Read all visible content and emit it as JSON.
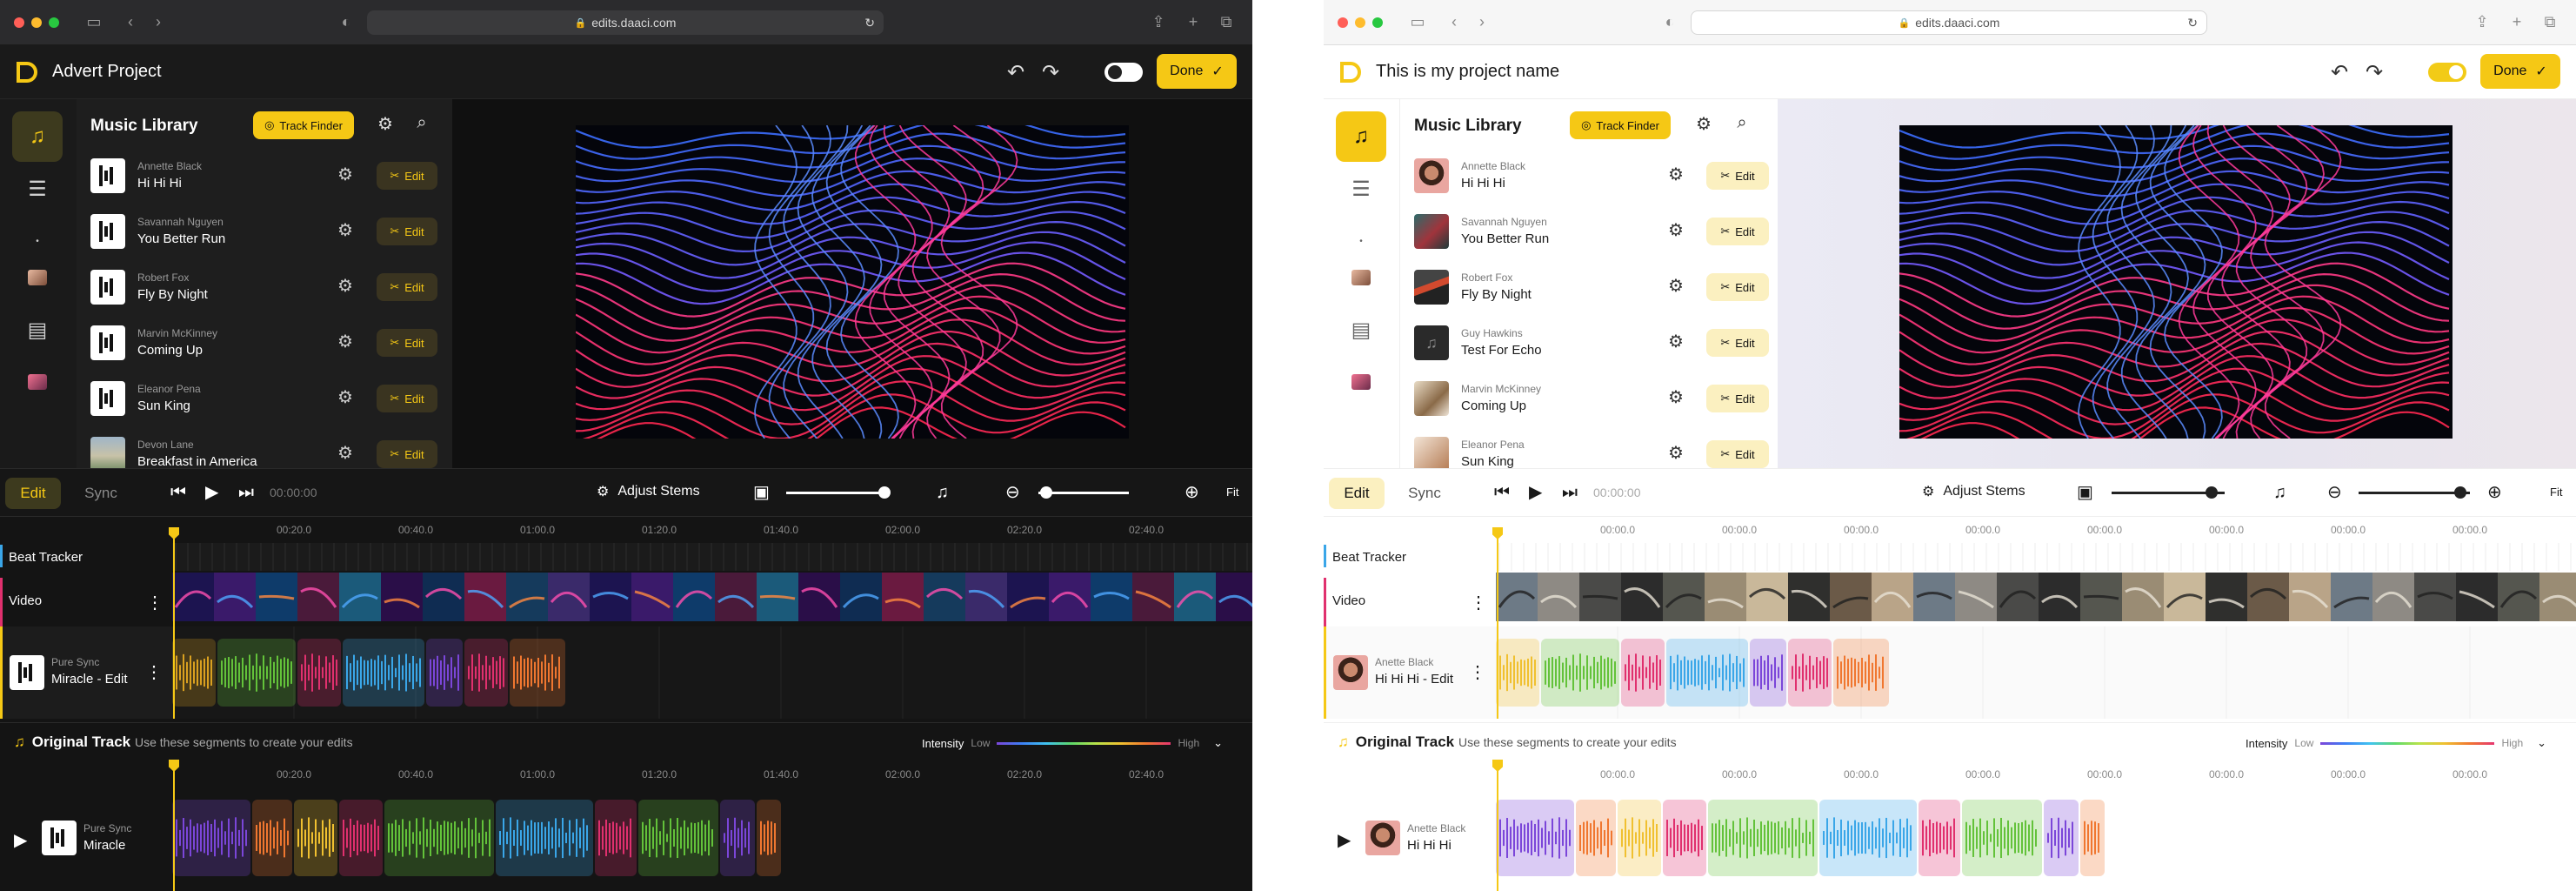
{
  "browser": {
    "url": "edits.daaci.com"
  },
  "dark": {
    "project_name": "Advert Project",
    "done_label": "Done",
    "library_title": "Music Library",
    "track_finder_label": "Track Finder",
    "edit_label": "Edit",
    "tracks": [
      {
        "artist": "Annette Black",
        "title": "Hi Hi Hi"
      },
      {
        "artist": "Savannah Nguyen",
        "title": "You Better Run"
      },
      {
        "artist": "Robert Fox",
        "title": "Fly By Night"
      },
      {
        "artist": "Marvin McKinney",
        "title": "Coming Up"
      },
      {
        "artist": "Eleanor Pena",
        "title": "Sun King"
      },
      {
        "artist": "Devon Lane",
        "title": "Breakfast in America"
      }
    ],
    "timeline": {
      "tab_edit": "Edit",
      "tab_sync": "Sync",
      "timecode": "00:00:00",
      "adjust_stems": "Adjust Stems",
      "fit": "Fit",
      "ruler": [
        "00:20.0",
        "00:40.0",
        "01:00.0",
        "01:20.0",
        "01:40.0",
        "02:00.0",
        "02:20.0",
        "02:40.0"
      ],
      "beat_tracker": "Beat Tracker",
      "video": "Video",
      "music_top": "Pure Sync",
      "music_bottom": "Miracle - Edit"
    },
    "original": {
      "title": "Original Track",
      "subtitle": "Use these segments to create your edits",
      "intensity": "Intensity",
      "low": "Low",
      "high": "High",
      "ruler": [
        "00:20.0",
        "00:40.0",
        "01:00.0",
        "01:20.0",
        "01:40.0",
        "02:00.0",
        "02:20.0",
        "02:40.0"
      ],
      "track_top": "Pure Sync",
      "track_bottom": "Miracle"
    }
  },
  "light": {
    "project_name": "This is my project name",
    "done_label": "Done",
    "library_title": "Music Library",
    "track_finder_label": "Track Finder",
    "edit_label": "Edit",
    "tracks": [
      {
        "artist": "Annette Black",
        "title": "Hi Hi Hi"
      },
      {
        "artist": "Savannah Nguyen",
        "title": "You Better Run"
      },
      {
        "artist": "Robert Fox",
        "title": "Fly By Night"
      },
      {
        "artist": "Guy Hawkins",
        "title": "Test For Echo"
      },
      {
        "artist": "Marvin McKinney",
        "title": "Coming Up"
      },
      {
        "artist": "Eleanor Pena",
        "title": "Sun King"
      }
    ],
    "timeline": {
      "tab_edit": "Edit",
      "tab_sync": "Sync",
      "timecode": "00:00:00",
      "adjust_stems": "Adjust Stems",
      "fit": "Fit",
      "ruler": [
        "00:00.0",
        "00:00.0",
        "00:00.0",
        "00:00.0",
        "00:00.0",
        "00:00.0",
        "00:00.0",
        "00:00.0"
      ],
      "beat_tracker": "Beat Tracker",
      "video": "Video",
      "music_top": "Anette Black",
      "music_bottom": "Hi Hi Hi - Edit"
    },
    "original": {
      "title": "Original Track",
      "subtitle": "Use these segments to create your edits",
      "intensity": "Intensity",
      "low": "Low",
      "high": "High",
      "ruler": [
        "00:00.0",
        "00:00.0",
        "00:00.0",
        "00:00.0",
        "00:00.0",
        "00:00.0",
        "00:00.0",
        "00:00.0"
      ],
      "track_top": "Anette Black",
      "track_bottom": "Hi Hi Hi"
    }
  },
  "colors": {
    "accent": "#f5c815",
    "segments": [
      "#d9a020",
      "#63c23a",
      "#e0306e",
      "#3aa6e8",
      "#7b46d9",
      "#e0306e",
      "#f07730"
    ],
    "orig_segments": [
      "#7b46d9",
      "#f07730",
      "#f0c030",
      "#e0306e",
      "#63c23a",
      "#3aa6e8",
      "#e0306e",
      "#63c23a",
      "#7b46d9",
      "#f07730"
    ]
  },
  "icons": {
    "traffic_lights": [
      "close",
      "minimize",
      "zoom"
    ],
    "sidebar": [
      "music-note-icon",
      "list-icon",
      "dot-icon",
      "image-icon",
      "stack-icon",
      "photo-icon"
    ]
  }
}
